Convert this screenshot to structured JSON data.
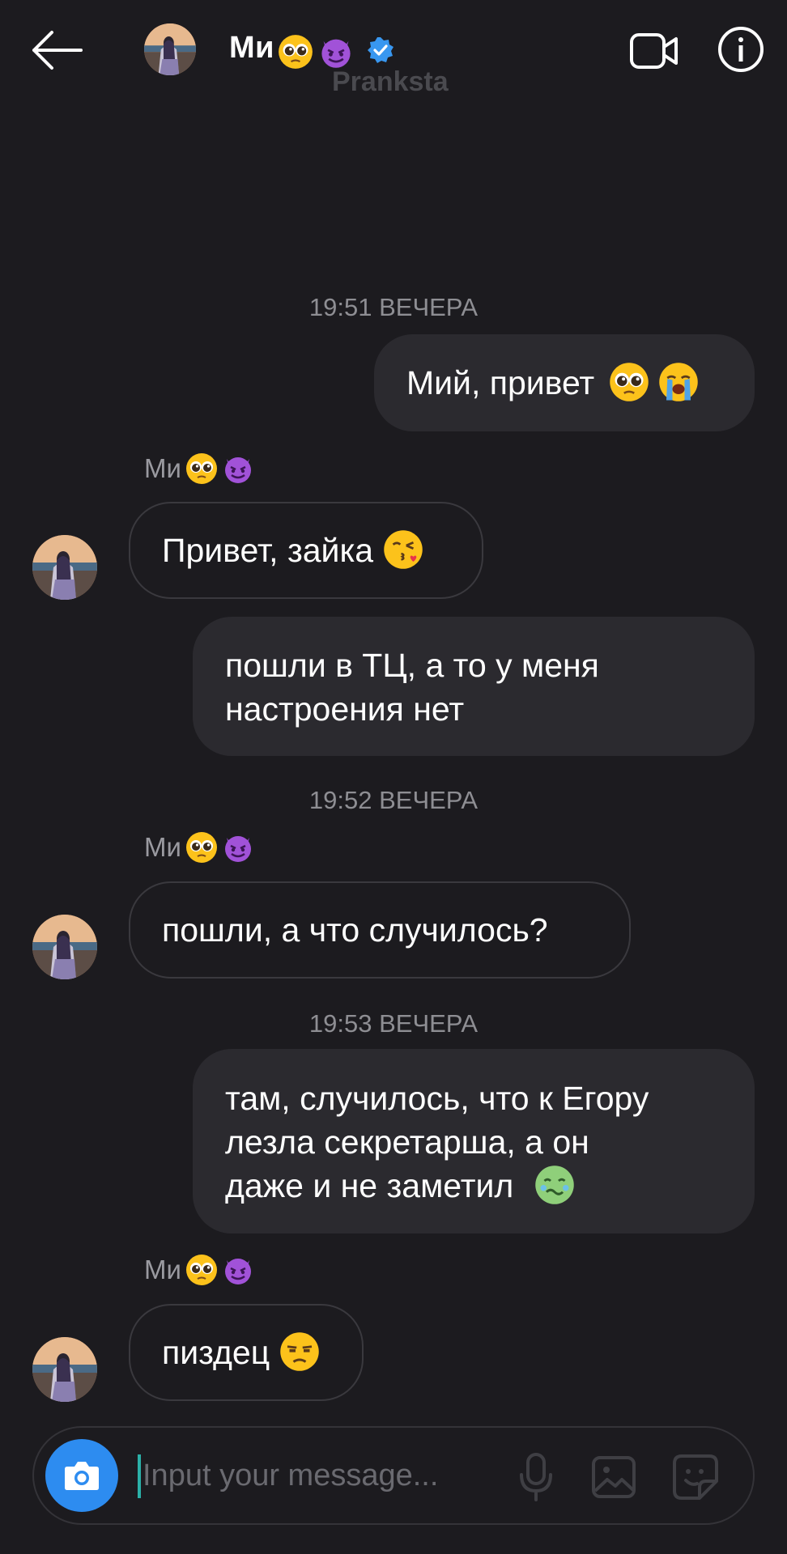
{
  "header": {
    "name": "Ми",
    "subtitle": "Pranksta",
    "name_emojis": [
      "pleading-face-emoji",
      "smiling-devil-emoji"
    ]
  },
  "messages": [
    {
      "kind": "timestamp",
      "text": "19:51 ВЕЧЕРА"
    },
    {
      "kind": "outgoing",
      "text": "Мий, привет",
      "emojis": [
        "pleading-face-emoji",
        "crying-face-emoji"
      ]
    },
    {
      "kind": "sender",
      "text": "Ми"
    },
    {
      "kind": "incoming",
      "text": "Привет, зайка",
      "emojis": [
        "kissing-face-emoji"
      ]
    },
    {
      "kind": "outgoing",
      "lines": [
        "пошли в ТЦ, а то у меня",
        "настроения нет"
      ]
    },
    {
      "kind": "timestamp",
      "text": "19:52 ВЕЧЕРА"
    },
    {
      "kind": "sender",
      "text": "Ми"
    },
    {
      "kind": "incoming",
      "text": "пошли, а что случилось?"
    },
    {
      "kind": "timestamp",
      "text": "19:53 ВЕЧЕРА"
    },
    {
      "kind": "outgoing",
      "lines": [
        "там, случилось, что к Егору",
        "лезла секретарша, а он",
        "даже и не заметил"
      ],
      "emojis": [
        "nauseated-face-emoji"
      ]
    },
    {
      "kind": "sender",
      "text": "Ми"
    },
    {
      "kind": "incoming",
      "text": "пиздец",
      "emojis": [
        "unamused-face-emoji"
      ]
    }
  ],
  "composer": {
    "placeholder": "Input your message..."
  },
  "colors": {
    "background": "#1c1b1f",
    "bubble_out": "#2b2a2f",
    "bubble_in_border": "#3a393e",
    "camera_button": "#2d8cf0",
    "verified": "#3897f0"
  }
}
